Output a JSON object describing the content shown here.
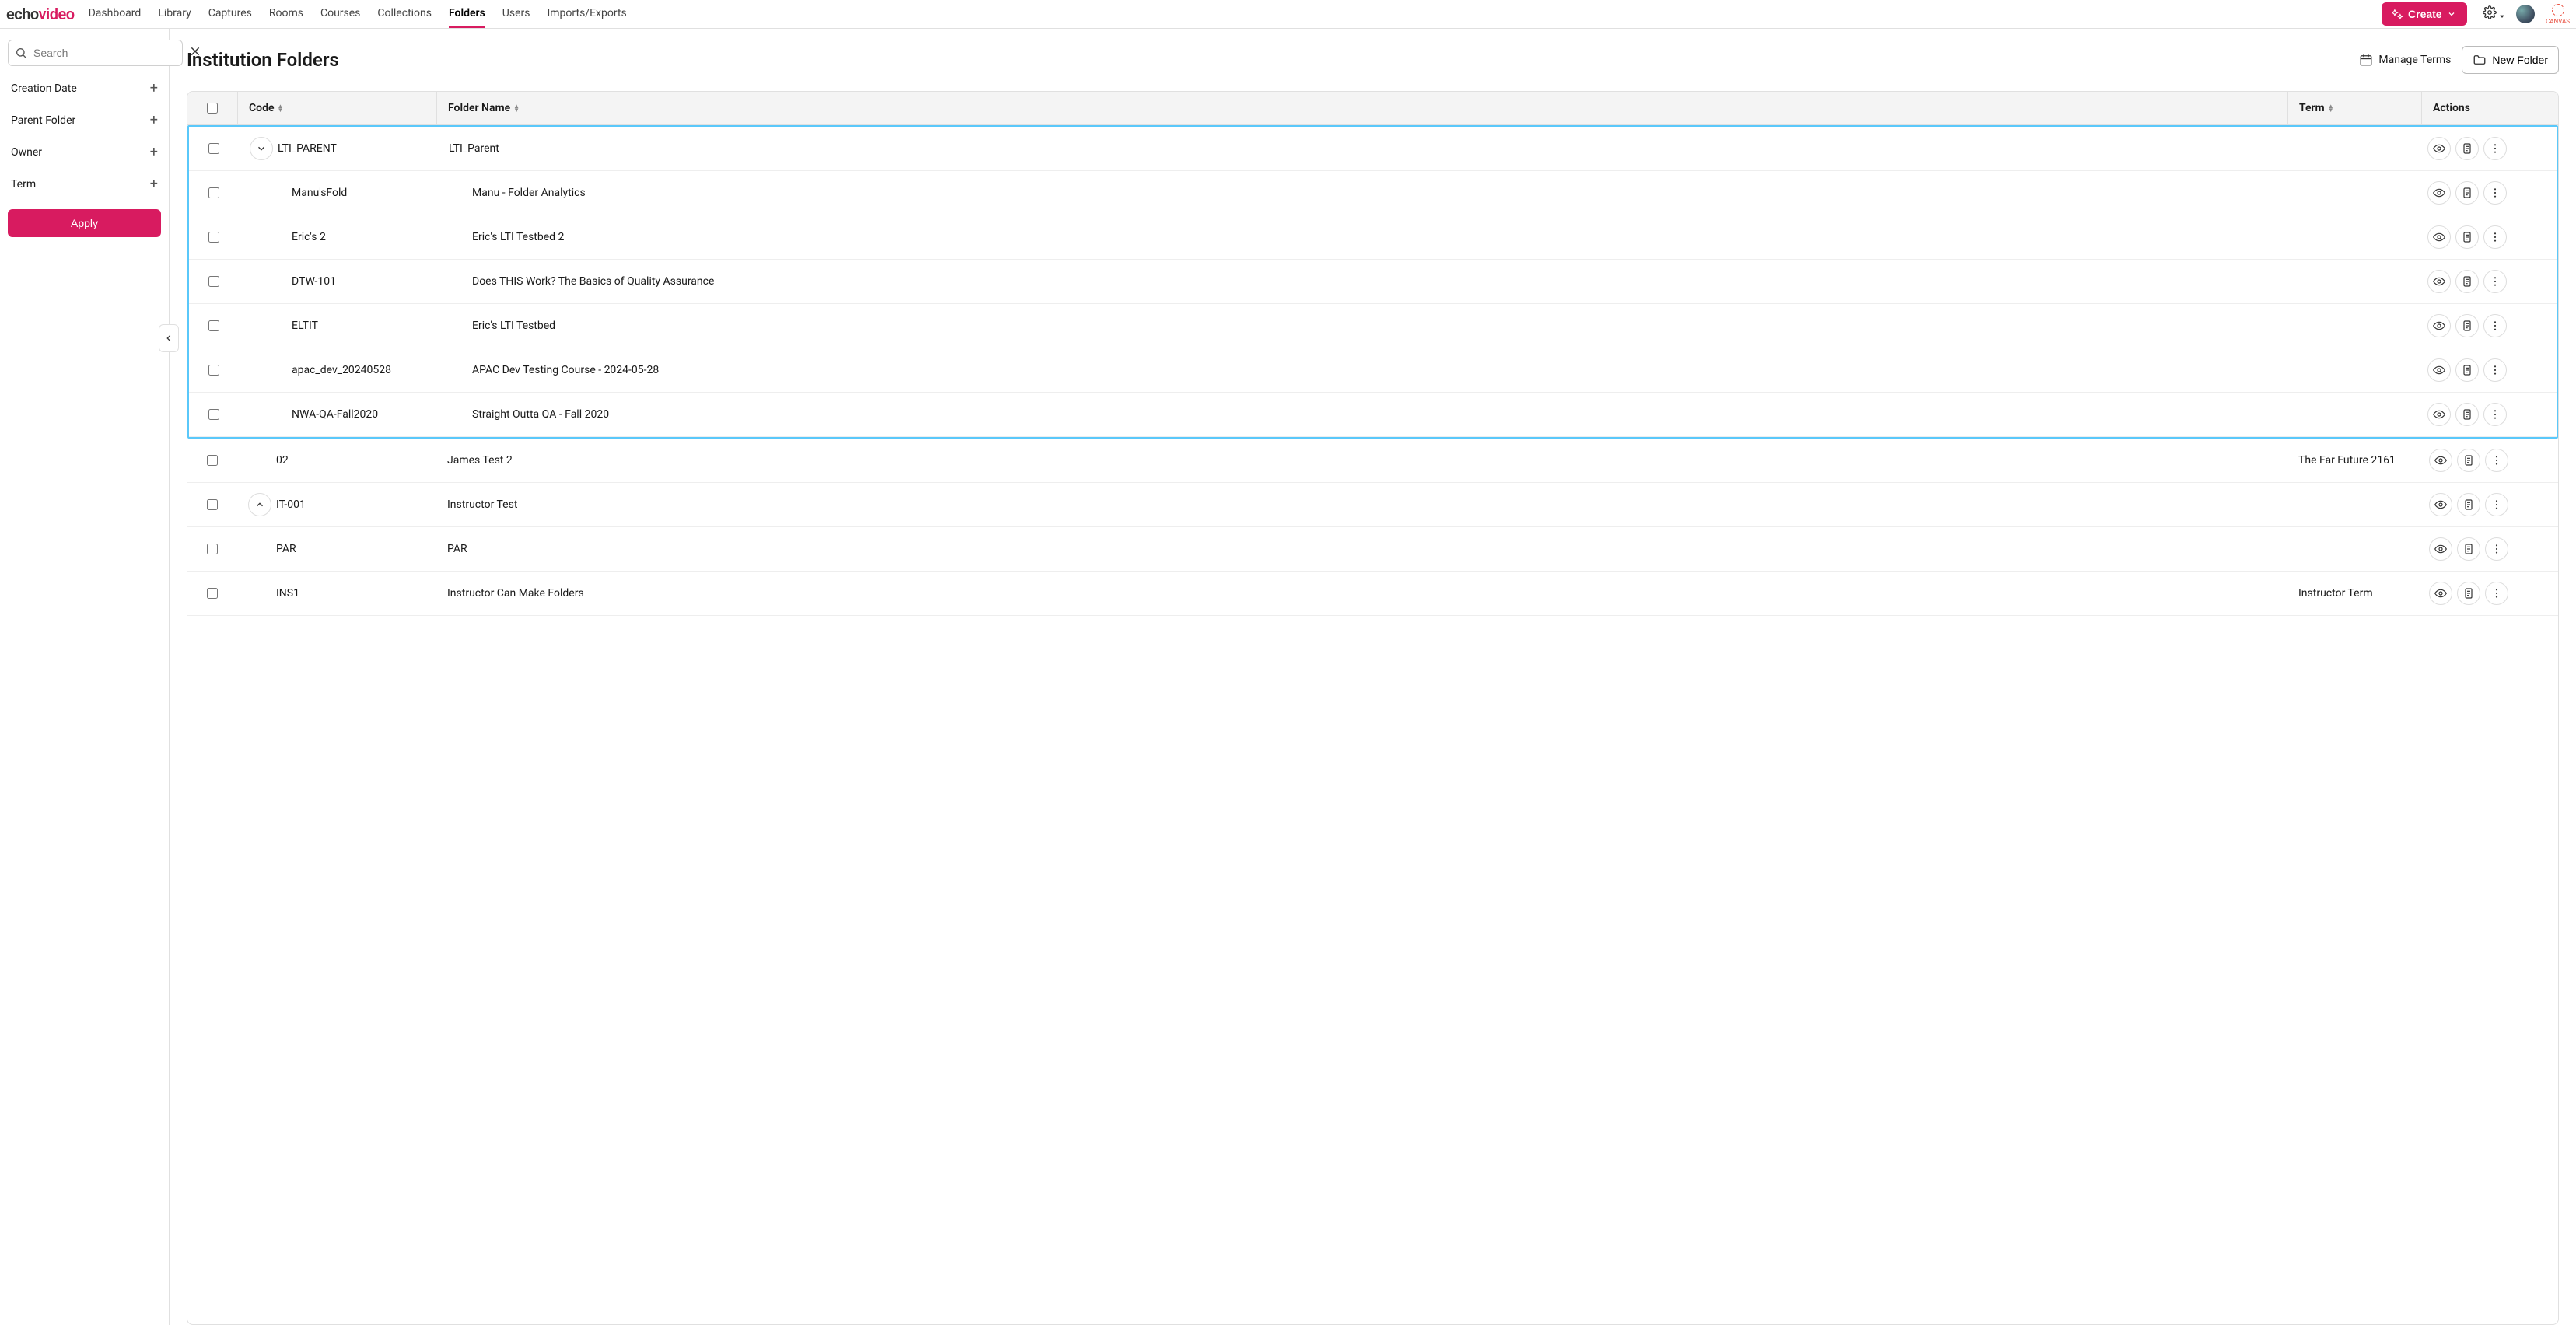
{
  "logo": {
    "part1": "echo",
    "part2": "video"
  },
  "nav": {
    "items": [
      {
        "label": "Dashboard",
        "active": false
      },
      {
        "label": "Library",
        "active": false
      },
      {
        "label": "Captures",
        "active": false
      },
      {
        "label": "Rooms",
        "active": false
      },
      {
        "label": "Courses",
        "active": false
      },
      {
        "label": "Collections",
        "active": false
      },
      {
        "label": "Folders",
        "active": true
      },
      {
        "label": "Users",
        "active": false
      },
      {
        "label": "Imports/Exports",
        "active": false
      }
    ],
    "create_label": "Create"
  },
  "header_right": {
    "canvas_label": "CANVAS"
  },
  "sidebar": {
    "search_placeholder": "Search",
    "filters": [
      {
        "label": "Creation Date"
      },
      {
        "label": "Parent Folder"
      },
      {
        "label": "Owner"
      },
      {
        "label": "Term"
      }
    ],
    "apply_label": "Apply"
  },
  "page": {
    "title": "Institution Folders",
    "manage_terms_label": "Manage Terms",
    "new_folder_label": "New Folder"
  },
  "table": {
    "columns": {
      "code": "Code",
      "name": "Folder Name",
      "term": "Term",
      "actions": "Actions"
    },
    "rows": [
      {
        "code": "LTI_PARENT",
        "name": "LTI_Parent",
        "term": "",
        "expand": "down",
        "child": false,
        "highlight": true
      },
      {
        "code": "Manu'sFold",
        "name": "Manu - Folder Analytics",
        "term": "",
        "expand": null,
        "child": true,
        "highlight": true
      },
      {
        "code": "Eric's 2",
        "name": "Eric's LTI Testbed 2",
        "term": "",
        "expand": null,
        "child": true,
        "highlight": true
      },
      {
        "code": "DTW-101",
        "name": "Does THIS Work? The Basics of Quality Assurance",
        "term": "",
        "expand": null,
        "child": true,
        "highlight": true
      },
      {
        "code": "ELTIT",
        "name": "Eric's LTI Testbed",
        "term": "",
        "expand": null,
        "child": true,
        "highlight": true
      },
      {
        "code": "apac_dev_20240528",
        "name": "APAC Dev Testing Course - 2024-05-28",
        "term": "",
        "expand": null,
        "child": true,
        "highlight": true
      },
      {
        "code": "NWA-QA-Fall2020",
        "name": "Straight Outta QA - Fall 2020",
        "term": "",
        "expand": null,
        "child": true,
        "highlight": true
      },
      {
        "code": "02",
        "name": "James Test 2",
        "term": "The Far Future 2161",
        "expand": null,
        "child": false,
        "highlight": false
      },
      {
        "code": "IT-001",
        "name": "Instructor Test",
        "term": "",
        "expand": "up",
        "child": false,
        "highlight": false
      },
      {
        "code": "PAR",
        "name": "PAR",
        "term": "",
        "expand": null,
        "child": false,
        "highlight": false
      },
      {
        "code": "INS1",
        "name": "Instructor Can Make Folders",
        "term": "Instructor Term",
        "expand": null,
        "child": false,
        "highlight": false
      }
    ]
  }
}
